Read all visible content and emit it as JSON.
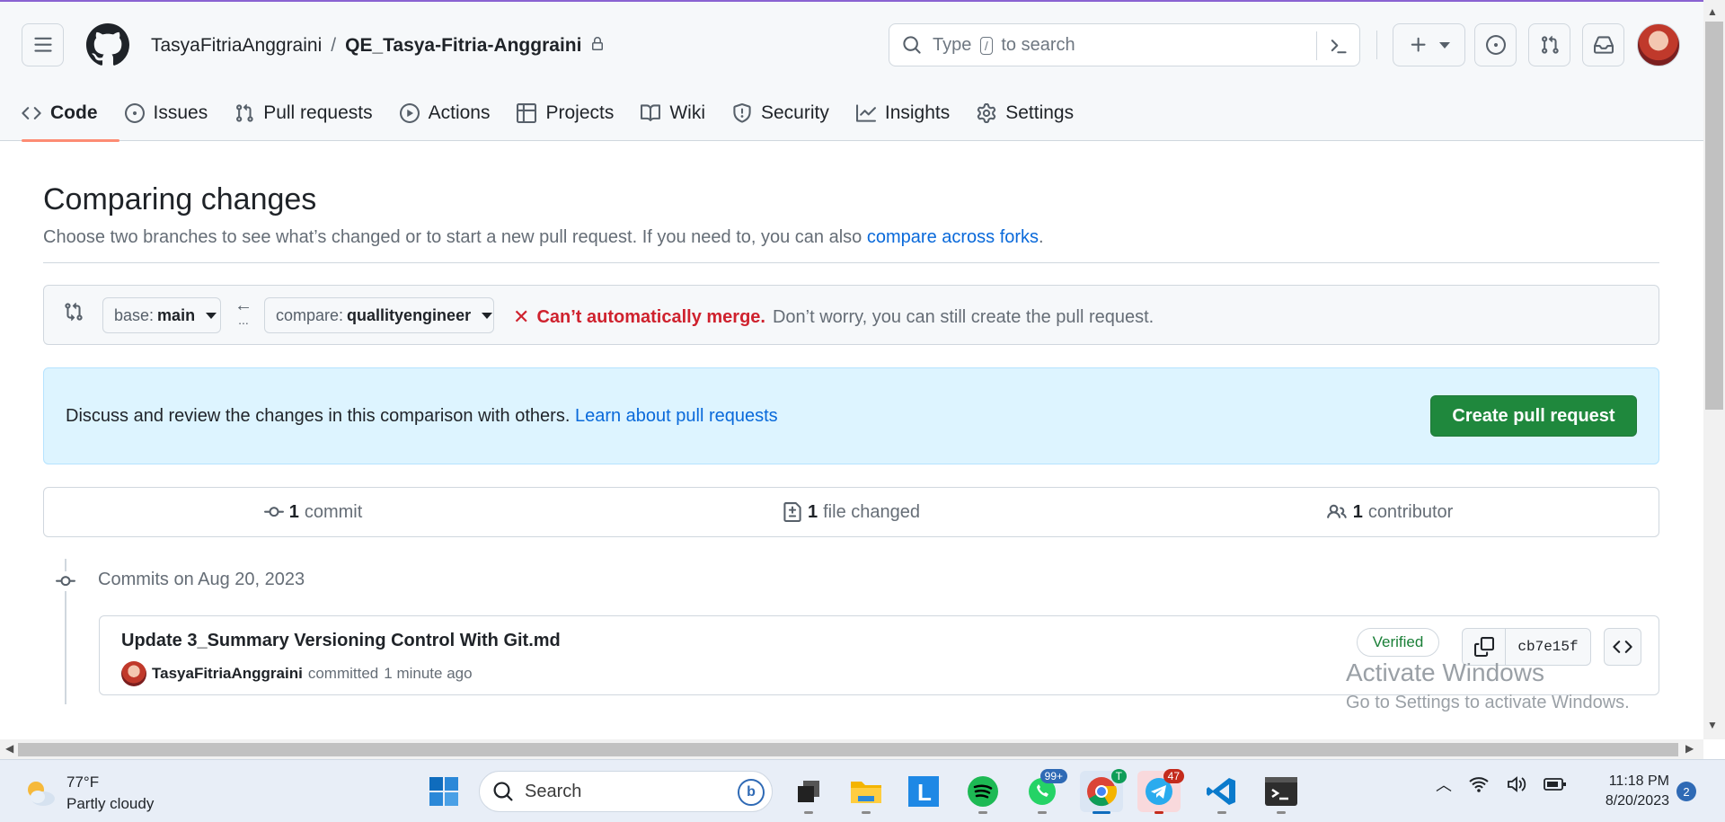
{
  "repo": {
    "owner": "TasyaFitriaAnggraini",
    "separator": "/",
    "name": "QE_Tasya-Fitria-Anggraini"
  },
  "search": {
    "before": "Type",
    "key": "/",
    "after": "to search"
  },
  "tabs": [
    {
      "label": "Code",
      "icon": "code-icon",
      "active": true
    },
    {
      "label": "Issues",
      "icon": "issue-icon"
    },
    {
      "label": "Pull requests",
      "icon": "pull-request-icon"
    },
    {
      "label": "Actions",
      "icon": "play-icon"
    },
    {
      "label": "Projects",
      "icon": "table-icon"
    },
    {
      "label": "Wiki",
      "icon": "book-icon"
    },
    {
      "label": "Security",
      "icon": "shield-icon"
    },
    {
      "label": "Insights",
      "icon": "graph-icon"
    },
    {
      "label": "Settings",
      "icon": "gear-icon"
    }
  ],
  "page": {
    "title": "Comparing changes",
    "subtitle": "Choose two branches to see what’s changed or to start a new pull request. If you need to, you can also",
    "subtitle_link": "compare across forks",
    "subtitle_end": "."
  },
  "range": {
    "base_label": "base:",
    "base_value": "main",
    "arrow": "←",
    "dots": "...",
    "compare_label": "compare:",
    "compare_value": "quallityengineer",
    "merge_status": "Can’t automatically merge.",
    "merge_note": "Don’t worry, you can still create the pull request."
  },
  "blankslate": {
    "text": "Discuss and review the changes in this comparison with others.",
    "link": "Learn about pull requests",
    "button": "Create pull request"
  },
  "summary": {
    "commits_count": "1",
    "commits_label": "commit",
    "files_count": "1",
    "files_label": "file changed",
    "contributors_count": "1",
    "contributors_label": "contributor"
  },
  "commits": {
    "date_heading": "Commits on Aug 20, 2023",
    "items": [
      {
        "title": "Update 3_Summary Versioning Control With Git.md",
        "author": "TasyaFitriaAnggraini",
        "action": "committed",
        "time": "1 minute ago",
        "verified": "Verified",
        "sha": "cb7e15f"
      }
    ]
  },
  "watermark": {
    "line1": "Activate Windows",
    "line2": "Go to Settings to activate Windows."
  },
  "taskbar": {
    "temp": "77°F",
    "condition": "Partly cloudy",
    "search_label": "Search",
    "whatsapp_badge": "99+",
    "telegram_badge": "47",
    "chrome_badge": "T",
    "time": "11:18 PM",
    "date": "8/20/2023",
    "notifications": "2"
  },
  "colors": {
    "accent_green": "#1f883d",
    "link_blue": "#0969da",
    "error_red": "#cf222e",
    "tab_underline": "#fd8c73"
  }
}
